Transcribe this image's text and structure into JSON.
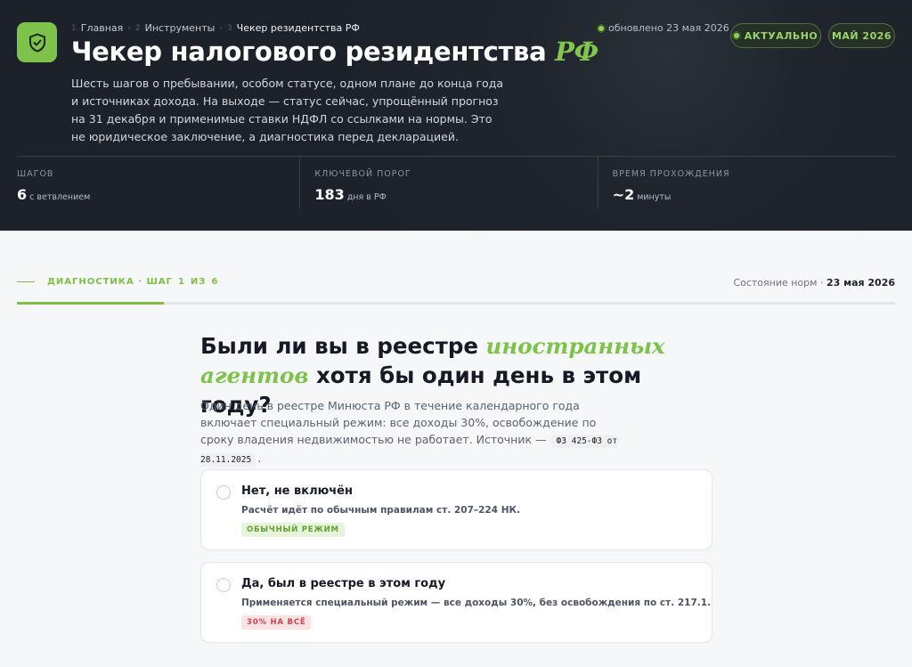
{
  "header": {
    "breadcrumb": [
      {
        "num": "1",
        "label": "Главная"
      },
      {
        "num": "2",
        "label": "Инструменты"
      },
      {
        "num": "3",
        "label": "Чекер резидентства РФ"
      }
    ],
    "updated": "обновлено 23 мая 2026",
    "badge_status": "АКТУАЛЬНО",
    "badge_date": "МАЙ 2026",
    "title": "Чекер налогового резидентства",
    "title_accent": "РФ",
    "intro": "Шесть шагов о пребывании, особом статусе, одном плане до конца года и источниках дохода. На выходе — статус сейчас, упрощённый прогноз на 31 декабря и применимые ставки НДФЛ со ссылками на нормы. Это не юридическое заключение, а диагностика перед декларацией.",
    "stats": [
      {
        "label": "ШАГОВ",
        "value": "6",
        "unit": "с ветвлением"
      },
      {
        "label": "КЛЮЧЕВОЙ ПОРОГ",
        "value": "183",
        "unit": "дня в РФ"
      },
      {
        "label": "ВРЕМЯ ПРОХОЖДЕНИЯ",
        "value": "~2",
        "unit": "минуты"
      }
    ]
  },
  "progress": {
    "label": "ДИАГНОСТИКА · ШАГ",
    "step": "1",
    "of": "ИЗ",
    "total": "6",
    "norms_label": "Состояние норм ·",
    "norms_date": "23 мая 2026",
    "fraction": 0.167
  },
  "question": {
    "text_1": "Были ли вы в реестре ",
    "accent": "иностранных агентов",
    "text_2": " хотя бы один день в этом году?",
    "desc": "Один день в реестре Минюста РФ в течение календарного года включает специальный режим: все доходы 30%, освобождение по сроку владения недвижимостью не работает. Источник —",
    "source": "ФЗ 425-ФЗ от 28.11.2025",
    "desc_end": "."
  },
  "options": [
    {
      "title": "Нет, не включён",
      "desc": "Расчёт идёт по обычным правилам ст. 207–224 НК.",
      "tag": "ОБЫЧНЫЙ РЕЖИМ",
      "tag_color": "#5f9f2e"
    },
    {
      "title": "Да, был в реестре в этом году",
      "desc": "Применяется специальный режим — все доходы 30%, без освобождения по ст. 217.1.",
      "tag": "30% НА ВСЁ",
      "tag_color": "#d0424d"
    }
  ],
  "colors": {
    "accent": "#7cc24b",
    "hero_bg": "#1e232b",
    "danger": "#d0424d"
  },
  "icons": {
    "logo": "shield-check-icon"
  }
}
